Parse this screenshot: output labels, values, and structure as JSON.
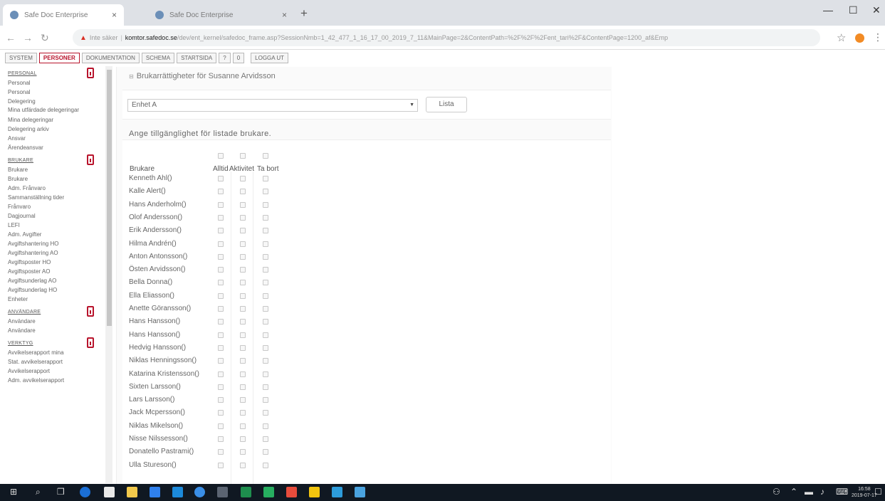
{
  "browser": {
    "tabs": [
      {
        "title": "Safe Doc Enterprise"
      },
      {
        "title": "Safe Doc Enterprise"
      }
    ],
    "address": {
      "security_label": "Inte säker",
      "host": "komtor.safedoc.se",
      "path": "/dev/ent_kernel/safedoc_frame.asp?SessionNmb=1_42_477_1_16_17_00_2019_7_11&MainPage=2&ContentPath=%2F%2F%2Fent_tari%2F&ContentPage=1200_af&Emp"
    }
  },
  "menu": {
    "items": [
      "SYSTEM",
      "PERSONER",
      "DOKUMENTATION",
      "SCHEMA",
      "STARTSIDA",
      "?",
      "0",
      "LOGGA UT"
    ],
    "active": "PERSONER"
  },
  "sidebar": {
    "sections": [
      {
        "heading": "PERSONAL",
        "items": [
          "Personal",
          "Personal",
          "Delegering",
          "Mina utfärdade delegeringar",
          "Mina delegeringar",
          "Delegering arkiv",
          "Ansvar",
          "Ärendeansvar"
        ]
      },
      {
        "heading": "BRUKARE",
        "items": [
          "Brukare",
          "Brukare",
          "Adm. Frånvaro",
          "Sammanställning tider",
          "Frånvaro",
          "Dagjournal",
          "LEFI",
          "Adm. Avgifter",
          "Avgiftshantering HO",
          "Avgiftshantering AO",
          "Avgiftsposter HO",
          "Avgiftsposter AO",
          "Avgiftsunderlag AO",
          "Avgiftsunderlag HO",
          "Enheter"
        ]
      },
      {
        "heading": "ANVÄNDARE",
        "items": [
          "Användare",
          "Användare"
        ]
      },
      {
        "heading": "VERKTYG",
        "items": [
          "Avvikelserapport mina",
          "Stat. avvikelserapport",
          "Avvikelserapport",
          "Adm. avvikelserapport"
        ]
      }
    ]
  },
  "main": {
    "title": "Brukarrättigheter för Susanne Arvidsson",
    "enhet_value": "Enhet A",
    "lista_label": "Lista",
    "instruction": "Ange tillgänglighet för listade brukare.",
    "col_brukare": "Brukare",
    "columns": [
      "Alltid",
      "Aktivitet",
      "Ta bort"
    ],
    "brukare": [
      "Kenneth Ahl()",
      "Kalle Alert()",
      "Hans Anderholm()",
      "Olof Andersson()",
      "Erik Andersson()",
      "Hilma Andrén()",
      "Anton Antonsson()",
      "Östen Arvidsson()",
      "Bella Donna()",
      "Ella Eliasson()",
      "Anette Göransson()",
      "Hans Hansson()",
      "Hans Hansson()",
      "Hedvig Hansson()",
      "Niklas Henningsson()",
      "Katarina Kristensson()",
      "Sixten Larsson()",
      "Lars Larsson()",
      "Jack Mcpersson()",
      "Niklas Mikelson()",
      "Nisse Nilssesson()",
      "Donatello Pastrami()",
      "Ulla Stureson()"
    ]
  },
  "taskbar": {
    "time": "16:58",
    "date": "2019-07-17"
  }
}
